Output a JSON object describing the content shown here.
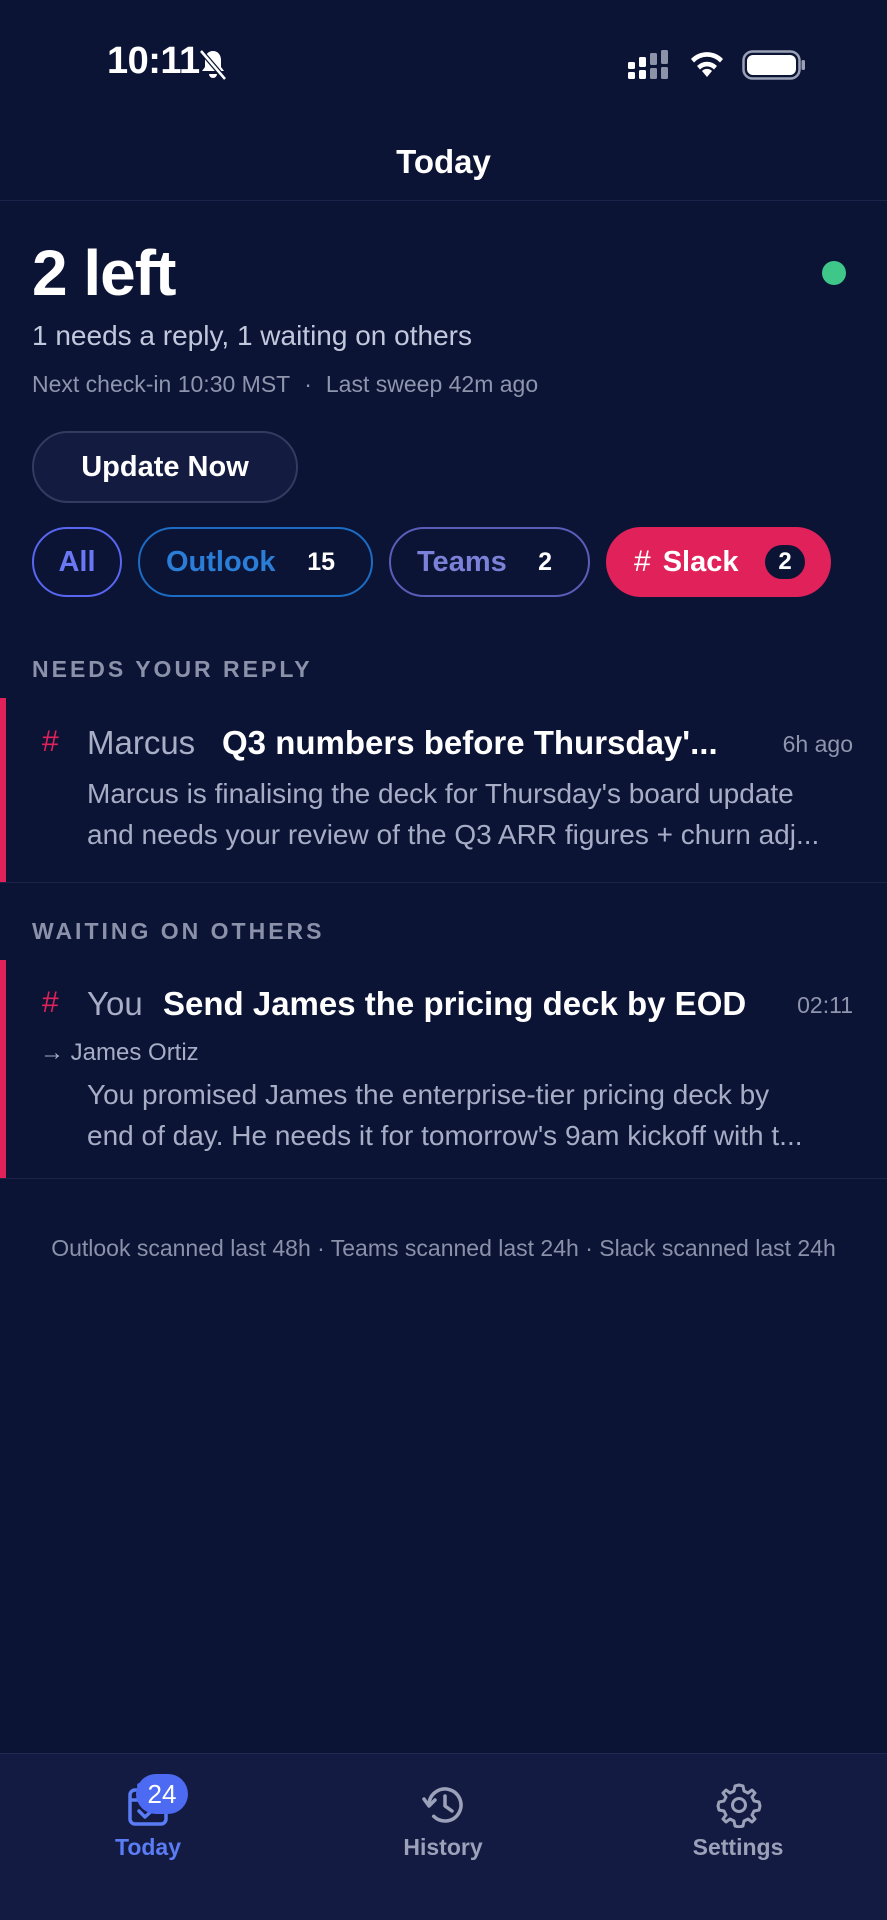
{
  "status_bar": {
    "time": "10:11",
    "icons": [
      "bell-slash-icon",
      "cellular-signal-icon",
      "wifi-icon",
      "battery-icon"
    ]
  },
  "nav": {
    "title": "Today"
  },
  "summary": {
    "count_label": "2 left",
    "subtitle": "1 needs a reply, 1 waiting on others",
    "next_checkin": "Next check-in 10:30 MST",
    "separator": "·",
    "last_sweep": "Last sweep 42m ago",
    "status_color": "#3fc78a"
  },
  "update_button": {
    "label": "Update Now"
  },
  "filters": {
    "all": {
      "label": "All"
    },
    "outlook": {
      "label": "Outlook",
      "count": "15",
      "color": "#2a7ed8"
    },
    "teams": {
      "label": "Teams",
      "count": "2",
      "color": "#7b80d8"
    },
    "slack": {
      "icon": "#",
      "label": "Slack",
      "count": "2",
      "color": "#e0215a",
      "selected": true
    }
  },
  "sections": {
    "needs_reply": {
      "title": "NEEDS YOUR REPLY",
      "items": [
        {
          "source_icon": "#",
          "sender": "Marcus",
          "subject": "Q3 numbers before Thursday'...",
          "time": "6h ago",
          "preview_line1": "Marcus is finalising the deck for Thursday's board update",
          "preview_line2": "and needs your review of the Q3 ARR figures + churn adj..."
        }
      ]
    },
    "waiting": {
      "title": "WAITING ON OTHERS",
      "items": [
        {
          "source_icon": "#",
          "sender": "You",
          "subject": "Send James the pricing deck by EOD",
          "time": "02:11",
          "recipient": "→ James Ortiz",
          "preview_line1": "You promised James the enterprise-tier pricing deck by",
          "preview_line2": "end of day. He needs it for tomorrow's 9am kickoff with t..."
        }
      ]
    }
  },
  "footer_note": "Outlook scanned last 48h · Teams scanned last 24h · Slack scanned last 24h",
  "tab_bar": {
    "today": {
      "label": "Today",
      "badge": "24",
      "active": true
    },
    "history": {
      "label": "History"
    },
    "settings": {
      "label": "Settings"
    }
  },
  "colors": {
    "background": "#0c1436",
    "accent_slack": "#e0215a",
    "accent_active_tab": "#5a7cf5"
  }
}
